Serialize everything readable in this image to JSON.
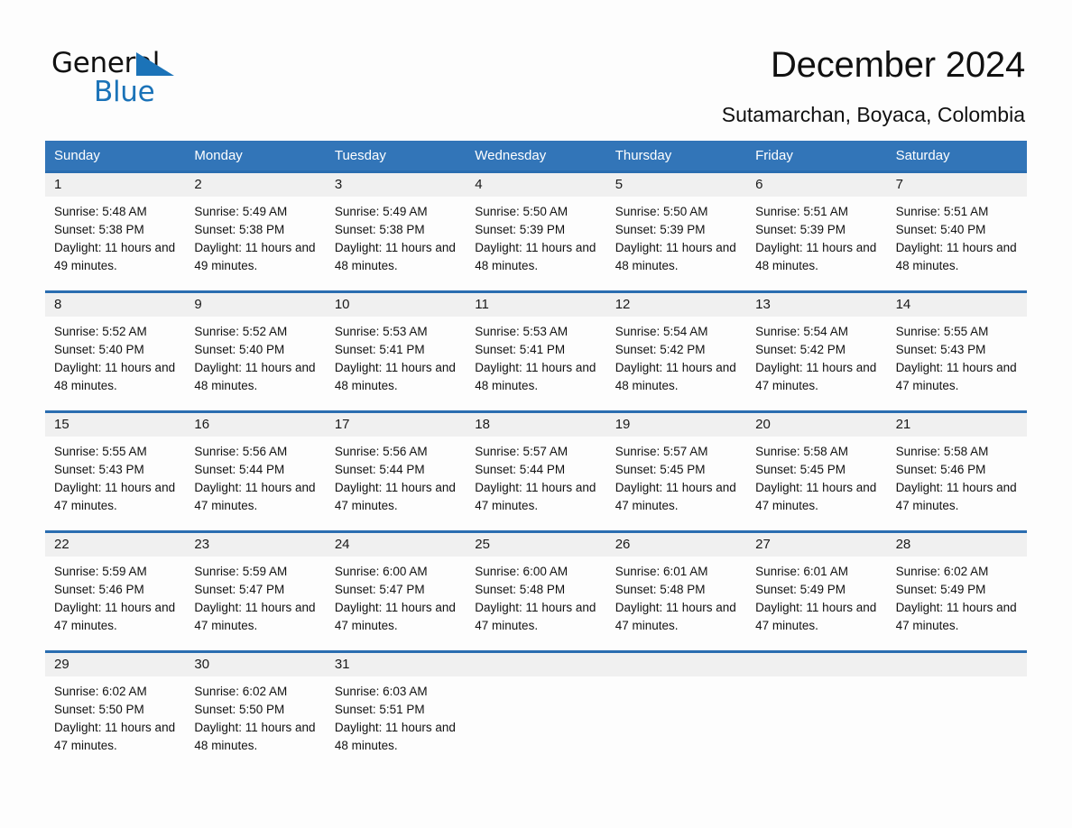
{
  "brand": {
    "name_part1": "General",
    "name_part2": "Blue",
    "logo_icon": "triangle-flag-icon",
    "accent_color": "#1b73b8"
  },
  "header": {
    "title": "December 2024",
    "location": "Sutamarchan, Boyaca, Colombia"
  },
  "calendar": {
    "header_bg": "#3275b8",
    "row_border_color": "#2a6db0",
    "daynum_band_bg": "#f0f0f0",
    "weekdays": [
      "Sunday",
      "Monday",
      "Tuesday",
      "Wednesday",
      "Thursday",
      "Friday",
      "Saturday"
    ],
    "weeks": [
      [
        {
          "day": "1",
          "sunrise": "Sunrise: 5:48 AM",
          "sunset": "Sunset: 5:38 PM",
          "daylight": "Daylight: 11 hours and 49 minutes."
        },
        {
          "day": "2",
          "sunrise": "Sunrise: 5:49 AM",
          "sunset": "Sunset: 5:38 PM",
          "daylight": "Daylight: 11 hours and 49 minutes."
        },
        {
          "day": "3",
          "sunrise": "Sunrise: 5:49 AM",
          "sunset": "Sunset: 5:38 PM",
          "daylight": "Daylight: 11 hours and 48 minutes."
        },
        {
          "day": "4",
          "sunrise": "Sunrise: 5:50 AM",
          "sunset": "Sunset: 5:39 PM",
          "daylight": "Daylight: 11 hours and 48 minutes."
        },
        {
          "day": "5",
          "sunrise": "Sunrise: 5:50 AM",
          "sunset": "Sunset: 5:39 PM",
          "daylight": "Daylight: 11 hours and 48 minutes."
        },
        {
          "day": "6",
          "sunrise": "Sunrise: 5:51 AM",
          "sunset": "Sunset: 5:39 PM",
          "daylight": "Daylight: 11 hours and 48 minutes."
        },
        {
          "day": "7",
          "sunrise": "Sunrise: 5:51 AM",
          "sunset": "Sunset: 5:40 PM",
          "daylight": "Daylight: 11 hours and 48 minutes."
        }
      ],
      [
        {
          "day": "8",
          "sunrise": "Sunrise: 5:52 AM",
          "sunset": "Sunset: 5:40 PM",
          "daylight": "Daylight: 11 hours and 48 minutes."
        },
        {
          "day": "9",
          "sunrise": "Sunrise: 5:52 AM",
          "sunset": "Sunset: 5:40 PM",
          "daylight": "Daylight: 11 hours and 48 minutes."
        },
        {
          "day": "10",
          "sunrise": "Sunrise: 5:53 AM",
          "sunset": "Sunset: 5:41 PM",
          "daylight": "Daylight: 11 hours and 48 minutes."
        },
        {
          "day": "11",
          "sunrise": "Sunrise: 5:53 AM",
          "sunset": "Sunset: 5:41 PM",
          "daylight": "Daylight: 11 hours and 48 minutes."
        },
        {
          "day": "12",
          "sunrise": "Sunrise: 5:54 AM",
          "sunset": "Sunset: 5:42 PM",
          "daylight": "Daylight: 11 hours and 48 minutes."
        },
        {
          "day": "13",
          "sunrise": "Sunrise: 5:54 AM",
          "sunset": "Sunset: 5:42 PM",
          "daylight": "Daylight: 11 hours and 47 minutes."
        },
        {
          "day": "14",
          "sunrise": "Sunrise: 5:55 AM",
          "sunset": "Sunset: 5:43 PM",
          "daylight": "Daylight: 11 hours and 47 minutes."
        }
      ],
      [
        {
          "day": "15",
          "sunrise": "Sunrise: 5:55 AM",
          "sunset": "Sunset: 5:43 PM",
          "daylight": "Daylight: 11 hours and 47 minutes."
        },
        {
          "day": "16",
          "sunrise": "Sunrise: 5:56 AM",
          "sunset": "Sunset: 5:44 PM",
          "daylight": "Daylight: 11 hours and 47 minutes."
        },
        {
          "day": "17",
          "sunrise": "Sunrise: 5:56 AM",
          "sunset": "Sunset: 5:44 PM",
          "daylight": "Daylight: 11 hours and 47 minutes."
        },
        {
          "day": "18",
          "sunrise": "Sunrise: 5:57 AM",
          "sunset": "Sunset: 5:44 PM",
          "daylight": "Daylight: 11 hours and 47 minutes."
        },
        {
          "day": "19",
          "sunrise": "Sunrise: 5:57 AM",
          "sunset": "Sunset: 5:45 PM",
          "daylight": "Daylight: 11 hours and 47 minutes."
        },
        {
          "day": "20",
          "sunrise": "Sunrise: 5:58 AM",
          "sunset": "Sunset: 5:45 PM",
          "daylight": "Daylight: 11 hours and 47 minutes."
        },
        {
          "day": "21",
          "sunrise": "Sunrise: 5:58 AM",
          "sunset": "Sunset: 5:46 PM",
          "daylight": "Daylight: 11 hours and 47 minutes."
        }
      ],
      [
        {
          "day": "22",
          "sunrise": "Sunrise: 5:59 AM",
          "sunset": "Sunset: 5:46 PM",
          "daylight": "Daylight: 11 hours and 47 minutes."
        },
        {
          "day": "23",
          "sunrise": "Sunrise: 5:59 AM",
          "sunset": "Sunset: 5:47 PM",
          "daylight": "Daylight: 11 hours and 47 minutes."
        },
        {
          "day": "24",
          "sunrise": "Sunrise: 6:00 AM",
          "sunset": "Sunset: 5:47 PM",
          "daylight": "Daylight: 11 hours and 47 minutes."
        },
        {
          "day": "25",
          "sunrise": "Sunrise: 6:00 AM",
          "sunset": "Sunset: 5:48 PM",
          "daylight": "Daylight: 11 hours and 47 minutes."
        },
        {
          "day": "26",
          "sunrise": "Sunrise: 6:01 AM",
          "sunset": "Sunset: 5:48 PM",
          "daylight": "Daylight: 11 hours and 47 minutes."
        },
        {
          "day": "27",
          "sunrise": "Sunrise: 6:01 AM",
          "sunset": "Sunset: 5:49 PM",
          "daylight": "Daylight: 11 hours and 47 minutes."
        },
        {
          "day": "28",
          "sunrise": "Sunrise: 6:02 AM",
          "sunset": "Sunset: 5:49 PM",
          "daylight": "Daylight: 11 hours and 47 minutes."
        }
      ],
      [
        {
          "day": "29",
          "sunrise": "Sunrise: 6:02 AM",
          "sunset": "Sunset: 5:50 PM",
          "daylight": "Daylight: 11 hours and 47 minutes."
        },
        {
          "day": "30",
          "sunrise": "Sunrise: 6:02 AM",
          "sunset": "Sunset: 5:50 PM",
          "daylight": "Daylight: 11 hours and 48 minutes."
        },
        {
          "day": "31",
          "sunrise": "Sunrise: 6:03 AM",
          "sunset": "Sunset: 5:51 PM",
          "daylight": "Daylight: 11 hours and 48 minutes."
        },
        {
          "day": "",
          "sunrise": "",
          "sunset": "",
          "daylight": ""
        },
        {
          "day": "",
          "sunrise": "",
          "sunset": "",
          "daylight": ""
        },
        {
          "day": "",
          "sunrise": "",
          "sunset": "",
          "daylight": ""
        },
        {
          "day": "",
          "sunrise": "",
          "sunset": "",
          "daylight": ""
        }
      ]
    ]
  }
}
